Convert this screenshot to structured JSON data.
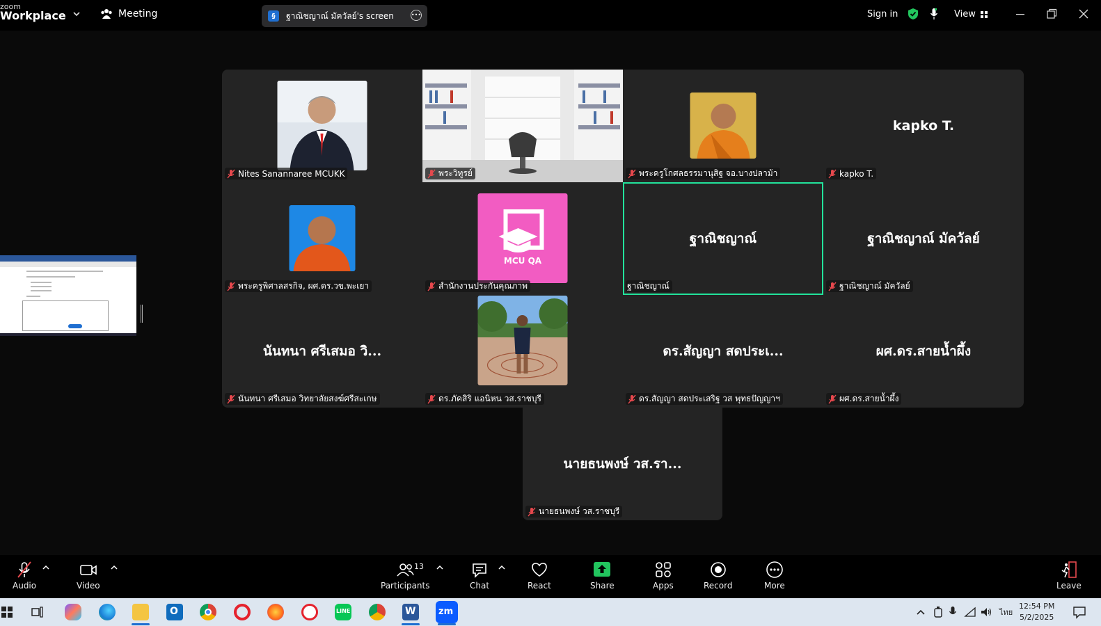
{
  "topbar": {
    "logo_small": "zoom",
    "logo_main": "Workplace",
    "meeting_label": "Meeting",
    "share_title": "ฐาณิชญาณ์ มัควัลย์'s screen",
    "sign_in": "Sign in",
    "view_label": "View"
  },
  "tiles": [
    {
      "label": "Nites Sanannaree MCUKK",
      "big": "",
      "photo": "man-suit",
      "muted": true
    },
    {
      "label": "พระวิทูรย์",
      "big": "",
      "photo": "library",
      "muted": true
    },
    {
      "label": "พระครูโกศลธรรมานุสิฐ จอ.บางปลาม้า",
      "big": "",
      "photo": "monk-orange",
      "muted": true
    },
    {
      "label": "kapko T.",
      "big": "kapko T.",
      "photo": "",
      "muted": true
    },
    {
      "label": "พระครูพิศาลสรกิจ, ผศ.ดร.วข.พะเยา",
      "big": "",
      "photo": "monk-blue",
      "muted": true
    },
    {
      "label": "สำนักงานประกันคุณภาพ",
      "big": "",
      "photo": "mcu-qa",
      "muted": true
    },
    {
      "label": "ฐาณิชญาณ์",
      "big": "ฐาณิชญาณ์",
      "photo": "",
      "muted": false,
      "active": true
    },
    {
      "label": "ฐาณิชญาณ์ มัควัลย์",
      "big": "ฐาณิชญาณ์ มัควัลย์",
      "photo": "",
      "muted": true
    },
    {
      "label": "นันทนา ศรีเสมอ วิทยาลัยสงฆ์ศรีสะเกษ",
      "big": "นันทนา ศรีเสมอ วิ...",
      "photo": "",
      "muted": true
    },
    {
      "label": "ดร.ภัคสิริ แอนิหน วส.ราชบุรี",
      "big": "",
      "photo": "woman-outdoor",
      "muted": true
    },
    {
      "label": "ดร.สัญญา สดประเสริฐ วส พุทธปัญญาฯ",
      "big": "ดร.สัญญา สดประเ...",
      "photo": "",
      "muted": true
    },
    {
      "label": "ผศ.ดร.สายน้ำผึ้ง",
      "big": "ผศ.ดร.สายน้ำผึ้ง",
      "photo": "",
      "muted": true
    }
  ],
  "extra_tile": {
    "label": "นายธนพงษ์ วส.ราชบุรี",
    "big": "นายธนพงษ์ วส.รา..."
  },
  "mcu_qa_text": "MCU QA",
  "toolbar": {
    "audio": "Audio",
    "video": "Video",
    "participants": "Participants",
    "participants_count": "13",
    "chat": "Chat",
    "react": "React",
    "share": "Share",
    "apps": "Apps",
    "record": "Record",
    "more": "More",
    "leave": "Leave"
  },
  "taskbar": {
    "lang": "ไทย",
    "time": "12:54 PM",
    "date": "5/2/2025"
  },
  "colors": {
    "active_border": "#22e39b",
    "share_green": "#22c55e",
    "muted_red": "#e5484d",
    "mcu_pink": "#f25cc2"
  }
}
